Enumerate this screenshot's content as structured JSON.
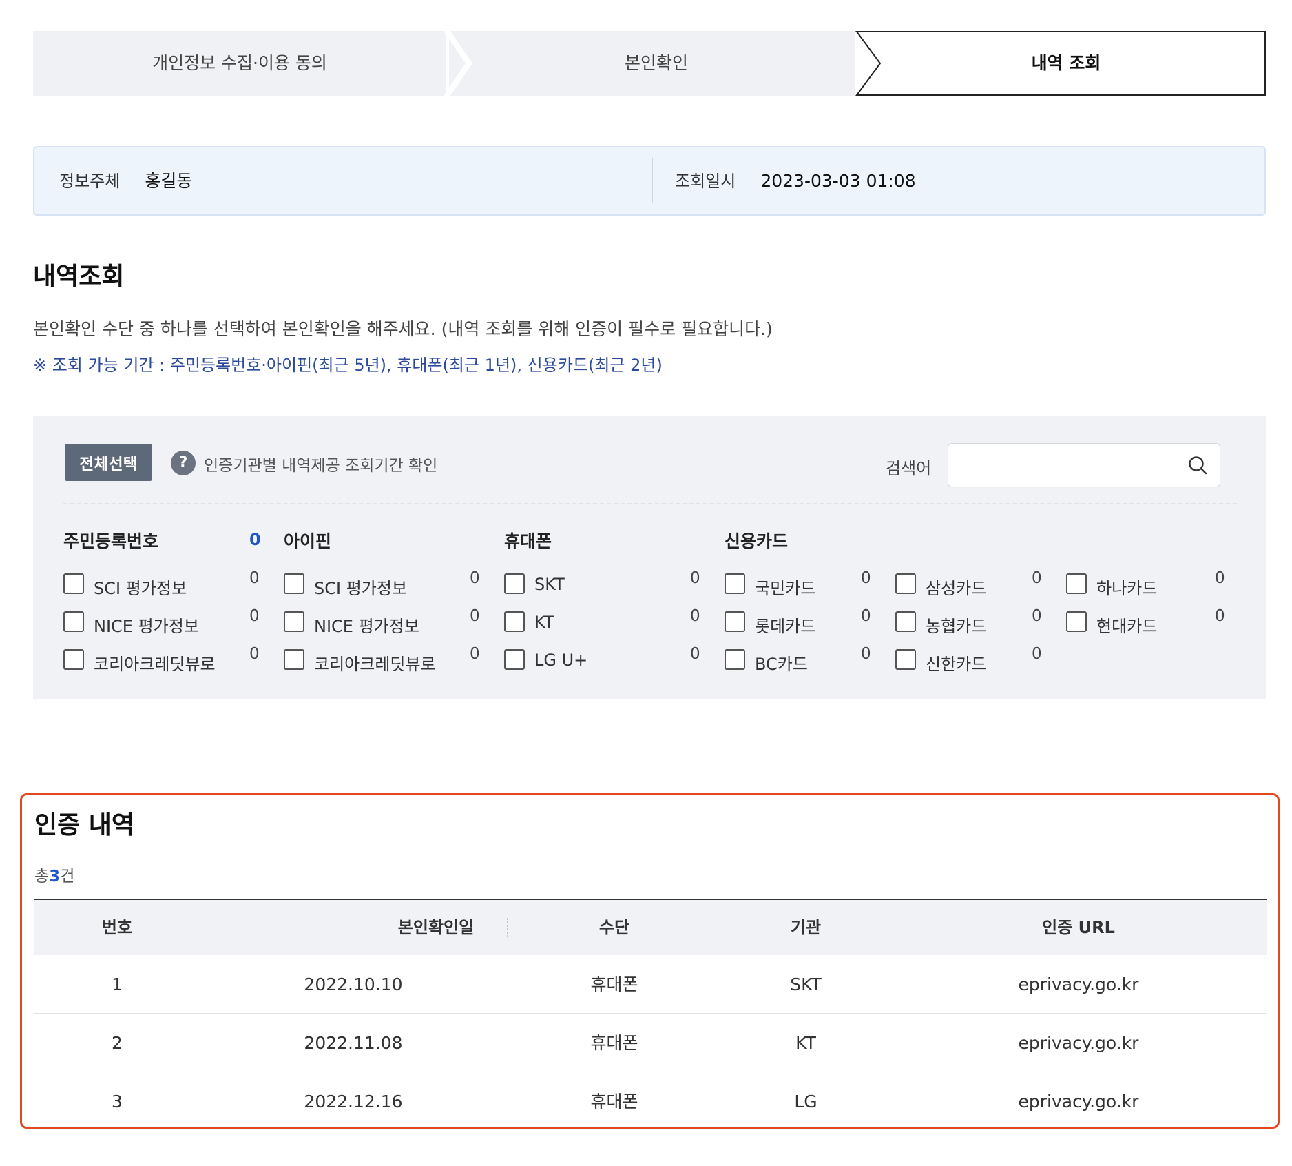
{
  "stepper": {
    "steps": [
      {
        "label": "개인정보 수집·이용 동의"
      },
      {
        "label": "본인확인"
      },
      {
        "label": "내역 조회"
      }
    ]
  },
  "info": {
    "subject_label": "정보주체",
    "subject_value": "홍길동",
    "date_label": "조회일시",
    "date_value": "2023-03-03 01:08"
  },
  "section": {
    "title": "내역조회",
    "description": "본인확인 수단 중 하나를 선택하여 본인확인을 해주세요. (내역 조회를 위해 인증이 필수로 필요합니다.)",
    "notice": "※ 조회 가능 기간 : 주민등록번호·아이핀(최근 5년), 휴대폰(최근 1년), 신용카드(최근 2년)"
  },
  "filter": {
    "select_all_label": "전체선택",
    "help_icon": "?",
    "help_text": "인증기관별 내역제공 조회기간 확인",
    "search_label": "검색어",
    "search_value": "",
    "categories": [
      {
        "name": "주민등록번호",
        "count": "0"
      },
      {
        "name": "아이핀"
      },
      {
        "name": "휴대폰"
      },
      {
        "name": "신용카드"
      }
    ],
    "options": {
      "resident": [
        {
          "label": "SCI 평가정보",
          "count": "0"
        },
        {
          "label": "NICE 평가정보",
          "count": "0"
        },
        {
          "label": "코리아크레딧뷰로",
          "count": "0"
        }
      ],
      "ipin": [
        {
          "label": "SCI 평가정보",
          "count": "0"
        },
        {
          "label": "NICE 평가정보",
          "count": "0"
        },
        {
          "label": "코리아크레딧뷰로",
          "count": "0"
        }
      ],
      "phone": [
        {
          "label": "SKT",
          "count": "0"
        },
        {
          "label": "KT",
          "count": "0"
        },
        {
          "label": "LG U+",
          "count": "0"
        }
      ],
      "card1": [
        {
          "label": "국민카드",
          "count": "0"
        },
        {
          "label": "롯데카드",
          "count": "0"
        },
        {
          "label": "BC카드",
          "count": "0"
        }
      ],
      "card2": [
        {
          "label": "삼성카드",
          "count": "0"
        },
        {
          "label": "농협카드",
          "count": "0"
        },
        {
          "label": "신한카드",
          "count": "0"
        }
      ],
      "card3": [
        {
          "label": "하나카드",
          "count": "0"
        },
        {
          "label": "현대카드",
          "count": "0"
        }
      ]
    }
  },
  "results": {
    "title": "인증 내역",
    "count_prefix": "총",
    "count": "3",
    "count_suffix": "건",
    "headers": [
      "번호",
      "본인확인일",
      "수단",
      "기관",
      "인증 URL"
    ],
    "rows": [
      [
        "1",
        "2022.10.10",
        "휴대폰",
        "SKT",
        "eprivacy.go.kr"
      ],
      [
        "2",
        "2022.11.08",
        "휴대폰",
        "KT",
        "eprivacy.go.kr"
      ],
      [
        "3",
        "2022.12.16",
        "휴대폰",
        "LG",
        "eprivacy.go.kr"
      ]
    ]
  }
}
